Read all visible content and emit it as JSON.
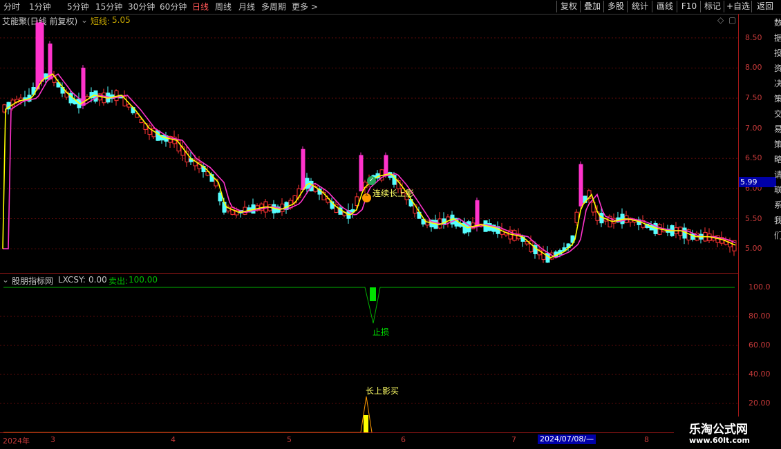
{
  "toolbar": {
    "periods": [
      "分时",
      "1分钟",
      "5分钟",
      "15分钟",
      "30分钟",
      "60分钟",
      "日线",
      "周线",
      "月线",
      "多周期",
      "更多 >"
    ],
    "active_period": "日线",
    "right_buttons": [
      "复权",
      "叠加",
      "多股",
      "统计",
      "画线",
      "F10",
      "标记",
      "+自选",
      "返回"
    ]
  },
  "main_panel": {
    "title": "艾能聚(日线 前复权)",
    "indicator_name": "短线:",
    "indicator_value": "5.05",
    "price_axis": [
      "8.50",
      "8.00",
      "7.50",
      "7.00",
      "6.50",
      "6.00",
      "5.50",
      "5.00"
    ],
    "current_price": "5.99",
    "annotation": "连续长上影",
    "side_text": "数据投资决策交易策略请联系我们"
  },
  "indicator_panel": {
    "title": "股朋指标网",
    "lxcsy_label": "LXCSY:",
    "lxcsy_value": "0.00",
    "sell_label": "卖出:",
    "sell_value": "100.00",
    "axis": [
      "100.0",
      "80.00",
      "60.00",
      "40.00",
      "20.00"
    ],
    "stop_loss_label": "止损",
    "long_shadow_sell_label": "长上影买"
  },
  "date_axis": {
    "labels": [
      "2024年",
      "3",
      "4",
      "5",
      "6",
      "7",
      "8"
    ],
    "cursor_date": "2024/07/08/—"
  },
  "watermark": {
    "line1": "乐淘公式网",
    "line2": "www.60lt.com"
  },
  "colors": {
    "up": "#ff3333",
    "down": "#54ffff",
    "magenta": "#ff33cc",
    "yellow_line": "#ffff00",
    "green_line": "#00c000"
  },
  "chart_data": {
    "type": "candlestick",
    "y_range": [
      4.6,
      8.9
    ],
    "x_labels": [
      "2024年",
      "3",
      "4",
      "5",
      "6",
      "7",
      "8"
    ],
    "short_line_value": 5.05,
    "last_price": 5.99
  }
}
